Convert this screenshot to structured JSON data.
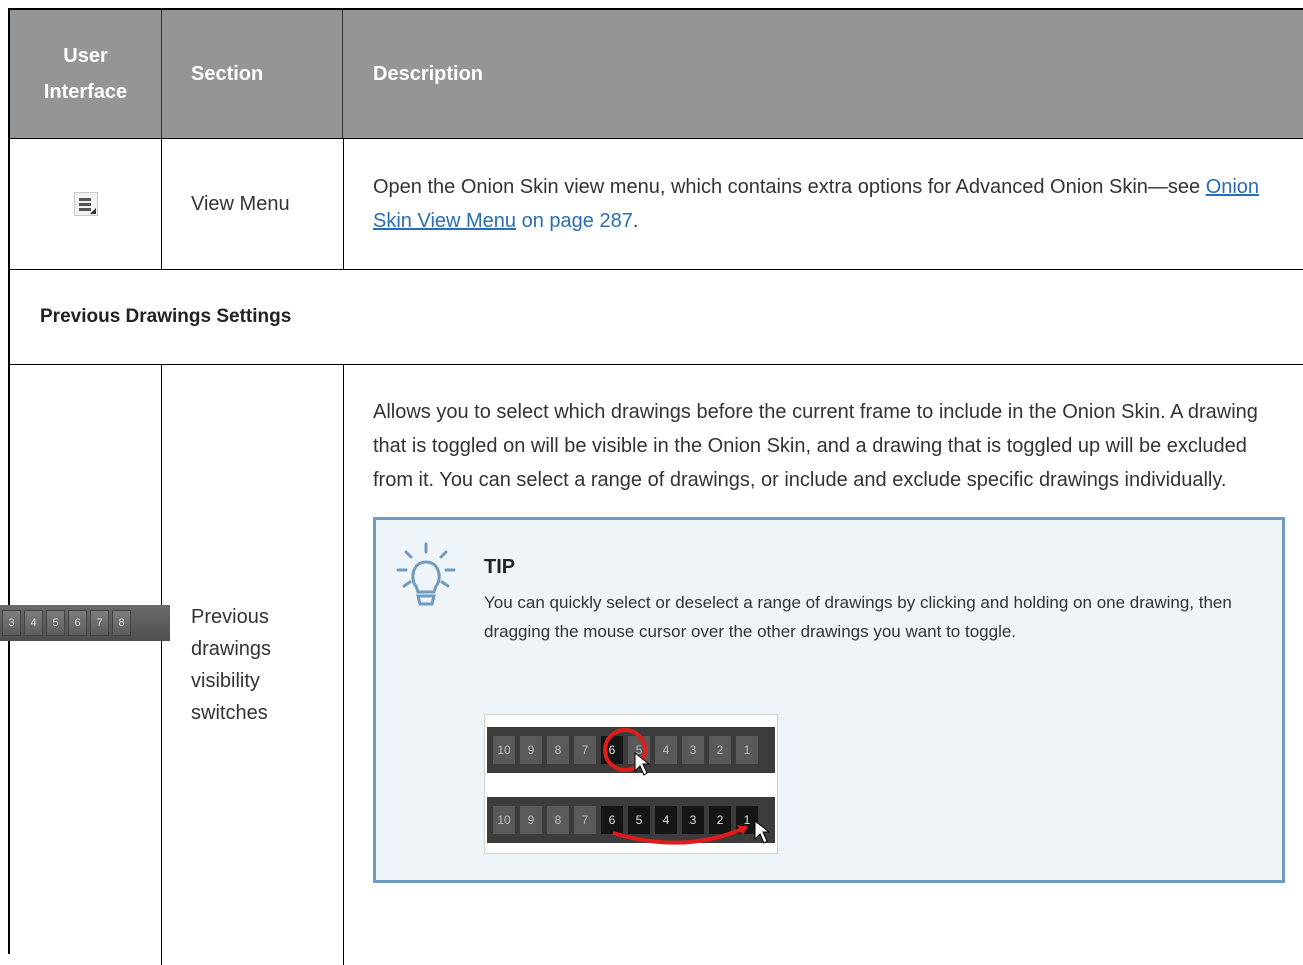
{
  "header": {
    "col1_line1": "User",
    "col1_line2": "Interface",
    "col2": "Section",
    "col3": "Description"
  },
  "row_view_menu": {
    "icon": "view-menu-icon",
    "section": "View Menu",
    "desc_prefix": "Open the Onion Skin view menu, which contains extra options for Advanced Onion Skin—see ",
    "link_text": "Onion Skin View Menu",
    "page_ref": " on page 287",
    "desc_suffix": "."
  },
  "section_heading": "Previous Drawings Settings",
  "row_previous": {
    "strip_numbers": [
      "3",
      "4",
      "5",
      "6",
      "7",
      "8"
    ],
    "section_line1": "Previous",
    "section_line2": "drawings",
    "section_line3": "visibility",
    "section_line4": "switches",
    "description": "Allows you to select which drawings before the current frame to include in the Onion Skin. A drawing that is toggled on will be visible in the Onion Skin, and a drawing that is toggled up will be excluded from it. You can select a range of drawings, or include and exclude specific drawings individually.",
    "tip": {
      "icon": "lightbulb-icon",
      "title": "TIP",
      "text": "You can quickly select or deselect a range of drawings by clicking and holding on one drawing, then dragging the mouse cursor over the other drawings you want to toggle.",
      "strip1": [
        "10",
        "9",
        "8",
        "7",
        "6",
        "5",
        "4",
        "3",
        "2",
        "1"
      ],
      "strip2": [
        "10",
        "9",
        "8",
        "7",
        "6",
        "5",
        "4",
        "3",
        "2",
        "1"
      ]
    }
  },
  "colors": {
    "header_bg": "#939597",
    "link": "#2a6cb5",
    "tip_border": "#6e9bbf",
    "tip_bg": "#eef4f8",
    "highlight": "#e21b1b"
  }
}
